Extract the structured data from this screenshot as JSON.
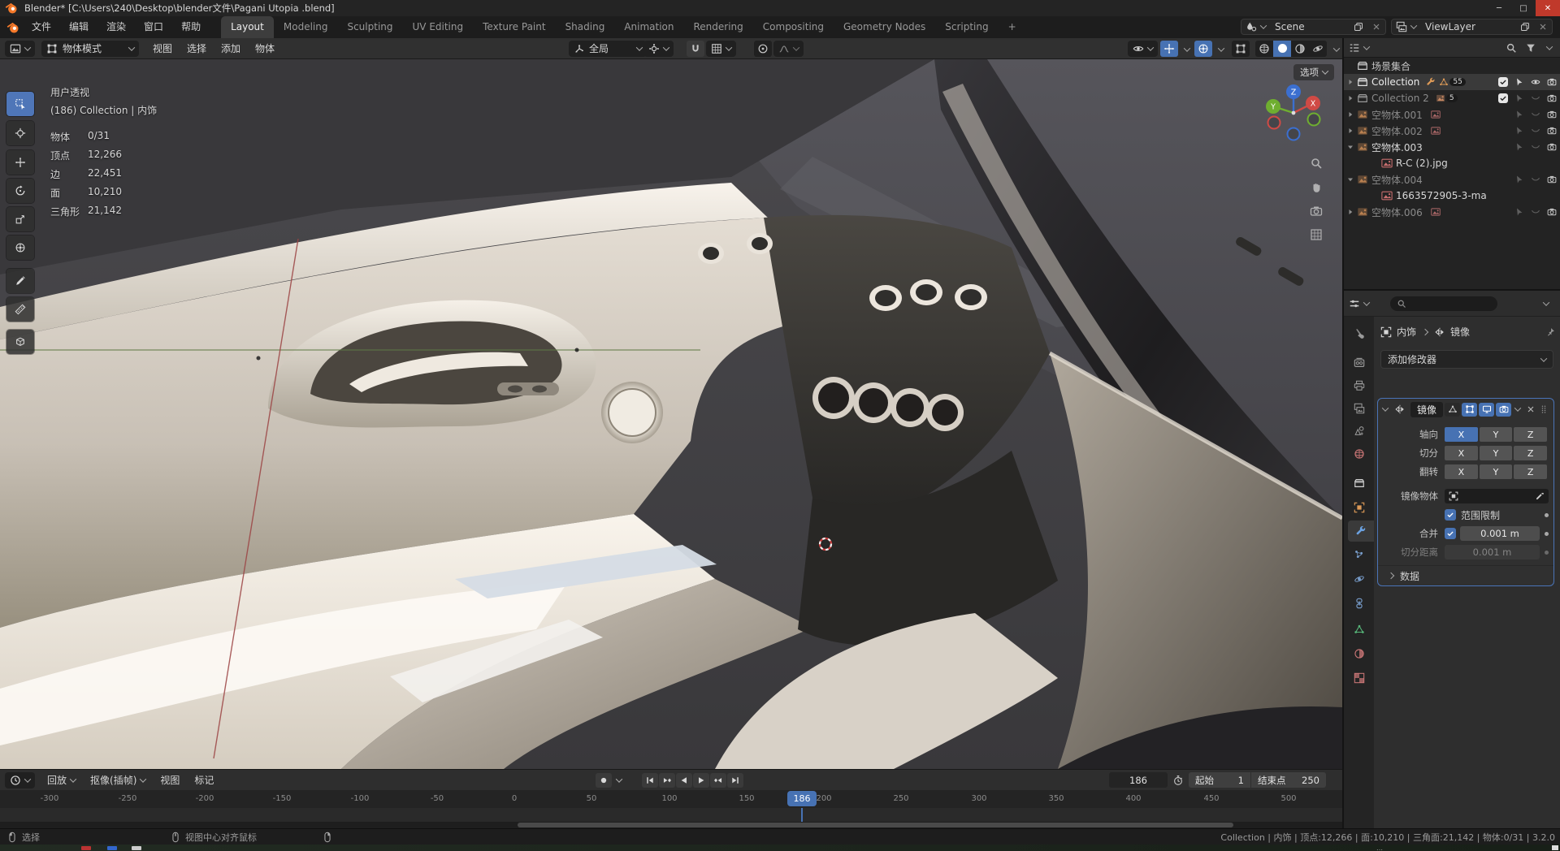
{
  "colors": {
    "accent_blue": "#4772b3",
    "object_orange": "#dd9a57",
    "data_pink": "#cf8a8a",
    "mesh_green": "#57b77a",
    "close_red": "#c0392b"
  },
  "titlebar": {
    "title": "Blender* [C:\\Users\\240\\Desktop\\blender文件\\Pagani Utopia .blend]",
    "minimize": "─",
    "maximize": "□",
    "close": "✕"
  },
  "topbar": {
    "menus": [
      "文件",
      "编辑",
      "渲染",
      "窗口",
      "帮助"
    ],
    "tabs": [
      "Layout",
      "Modeling",
      "Sculpting",
      "UV Editing",
      "Texture Paint",
      "Shading",
      "Animation",
      "Rendering",
      "Compositing",
      "Geometry Nodes",
      "Scripting"
    ],
    "add_tab": "+",
    "scene_label": "Scene",
    "viewlayer_label": "ViewLayer"
  },
  "viewport": {
    "mode": "物体模式",
    "menus": [
      "视图",
      "选择",
      "添加",
      "物体"
    ],
    "orientation": "全局",
    "options_label": "选项",
    "overlay_view": "用户透视",
    "overlay_context": "(186) Collection | 内饰",
    "stats": [
      {
        "k": "物体",
        "v": "0/31"
      },
      {
        "k": "顶点",
        "v": "12,266"
      },
      {
        "k": "边",
        "v": "22,451"
      },
      {
        "k": "面",
        "v": "10,210"
      },
      {
        "k": "三角形",
        "v": "21,142"
      }
    ],
    "gizmo": {
      "x": "X",
      "y": "Y",
      "z": "Z"
    }
  },
  "outliner": {
    "title_row": "场景集合",
    "rows": [
      {
        "label": "场景集合"
      },
      {
        "label": "Collection",
        "badge": "55"
      },
      {
        "label": "Collection 2",
        "badge": "5"
      },
      {
        "label": "空物体.001"
      },
      {
        "label": "空物体.002"
      },
      {
        "label": "空物体.003"
      },
      {
        "label": "R-C (2).jpg"
      },
      {
        "label": "空物体.004"
      },
      {
        "label": "1663572905-3-ma"
      },
      {
        "label": "空物体.006"
      }
    ]
  },
  "properties": {
    "breadcrumb_object": "内饰",
    "breadcrumb_modifier": "镜像",
    "add_modifier": "添加修改器",
    "tabs": [
      "tool",
      "render",
      "output",
      "view-layer",
      "scene",
      "world",
      "collection",
      "object",
      "modifiers",
      "particles",
      "physics",
      "constraints",
      "object-data",
      "material",
      "texture"
    ],
    "modifier": {
      "name": "镜像",
      "axis": "轴向",
      "bisect": "切分",
      "flip": "翻转",
      "x": "X",
      "y": "Y",
      "z": "Z",
      "mirror_object": "镜像物体",
      "clipping": "范围限制",
      "merge": "合并",
      "merge_value": "0.001 m",
      "bisect_distance": "切分距离",
      "bisect_distance_value": "0.001 m",
      "data_section": "数据"
    }
  },
  "timeline": {
    "menus": [
      "回放",
      "抠像(插帧)",
      "视图",
      "标记"
    ],
    "current_frame": "186",
    "start_label": "起始",
    "start_value": "1",
    "end_label": "结束点",
    "end_value": "250",
    "ruler": [
      "-300",
      "-250",
      "-200",
      "-150",
      "-100",
      "-50",
      "0",
      "50",
      "100",
      "150",
      "200",
      "250",
      "300",
      "350",
      "400",
      "450",
      "500"
    ]
  },
  "statusbar": {
    "left_select": "选择",
    "left_center": "视图中心对齐鼠标",
    "right": "Collection | 内饰 | 顶点:12,266 | 面:10,210 | 三角面:21,142 | 物体:0/31 | 3.2.0"
  }
}
